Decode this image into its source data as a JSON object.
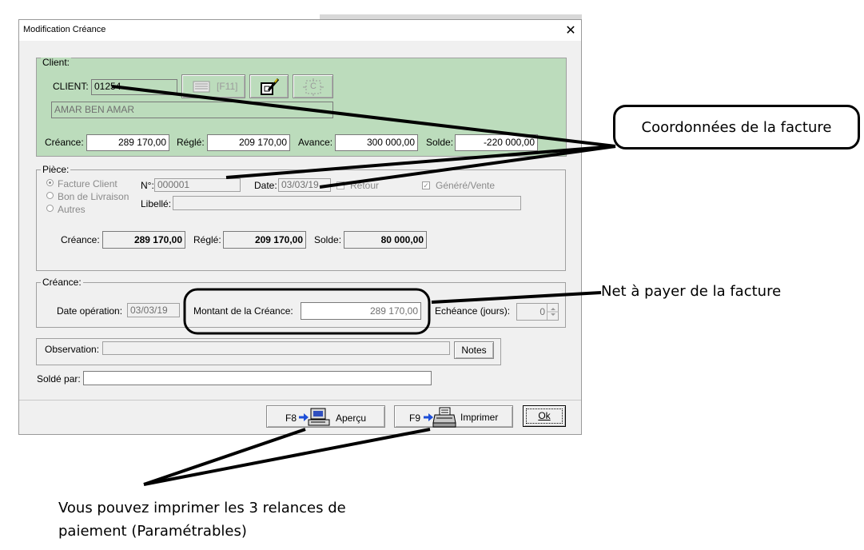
{
  "window": {
    "title": "Modification Créance",
    "close_glyph": "✕"
  },
  "client_group": {
    "legend": "Client:",
    "client_label": "CLIENT:",
    "client_code": "01254",
    "f11_label": "[F11]",
    "c_button_label": "C",
    "client_name": "AMAR BEN AMAR",
    "creance_label": "Créance:",
    "creance_value": "289 170,00",
    "regle_label": "Réglé:",
    "regle_value": "209 170,00",
    "avance_label": "Avance:",
    "avance_value": "300 000,00",
    "solde_label": "Solde:",
    "solde_value": "-220 000,00"
  },
  "piece_group": {
    "legend": "Pièce:",
    "radio_options": [
      "Facture Client",
      "Bon de Livraison",
      "Autres"
    ],
    "num_label": "N°:",
    "num_value": "000001",
    "date_label": "Date:",
    "date_value": "03/03/19",
    "retour_label": "Retour",
    "genere_label": "Généré/Vente",
    "libelle_label": "Libellé:",
    "libelle_value": "",
    "creance_label": "Créance:",
    "creance_value": "289 170,00",
    "regle_label": "Réglé:",
    "regle_value": "209 170,00",
    "solde_label": "Solde:",
    "solde_value": "80 000,00"
  },
  "creance_group": {
    "legend": "Créance:",
    "date_op_label": "Date opération:",
    "date_op_value": "03/03/19",
    "montant_label": "Montant de la Créance:",
    "montant_value": "289 170,00",
    "echeance_label": "Echéance (jours):",
    "echeance_value": "0"
  },
  "observation": {
    "label": "Observation:",
    "value": "",
    "notes_button": "Notes"
  },
  "solde_par": {
    "label": "Soldé par:",
    "value": ""
  },
  "footer": {
    "apercu_key": "F8",
    "apercu_label": "Aperçu",
    "imprimer_key": "F9",
    "imprimer_label": "Imprimer",
    "ok_label": "Ok"
  },
  "annotations": {
    "coordonnees": "Coordonnées de la facture",
    "net_a_payer": "Net à payer de la facture",
    "relances_line1": "Vous pouvez imprimer les 3 relances de",
    "relances_line2": "paiement (Paramétrables)"
  },
  "colors": {
    "client_panel": "#bcdcbc",
    "dialog_bg": "#f0f0f0",
    "arrow_blue": "#1e4fd8"
  }
}
